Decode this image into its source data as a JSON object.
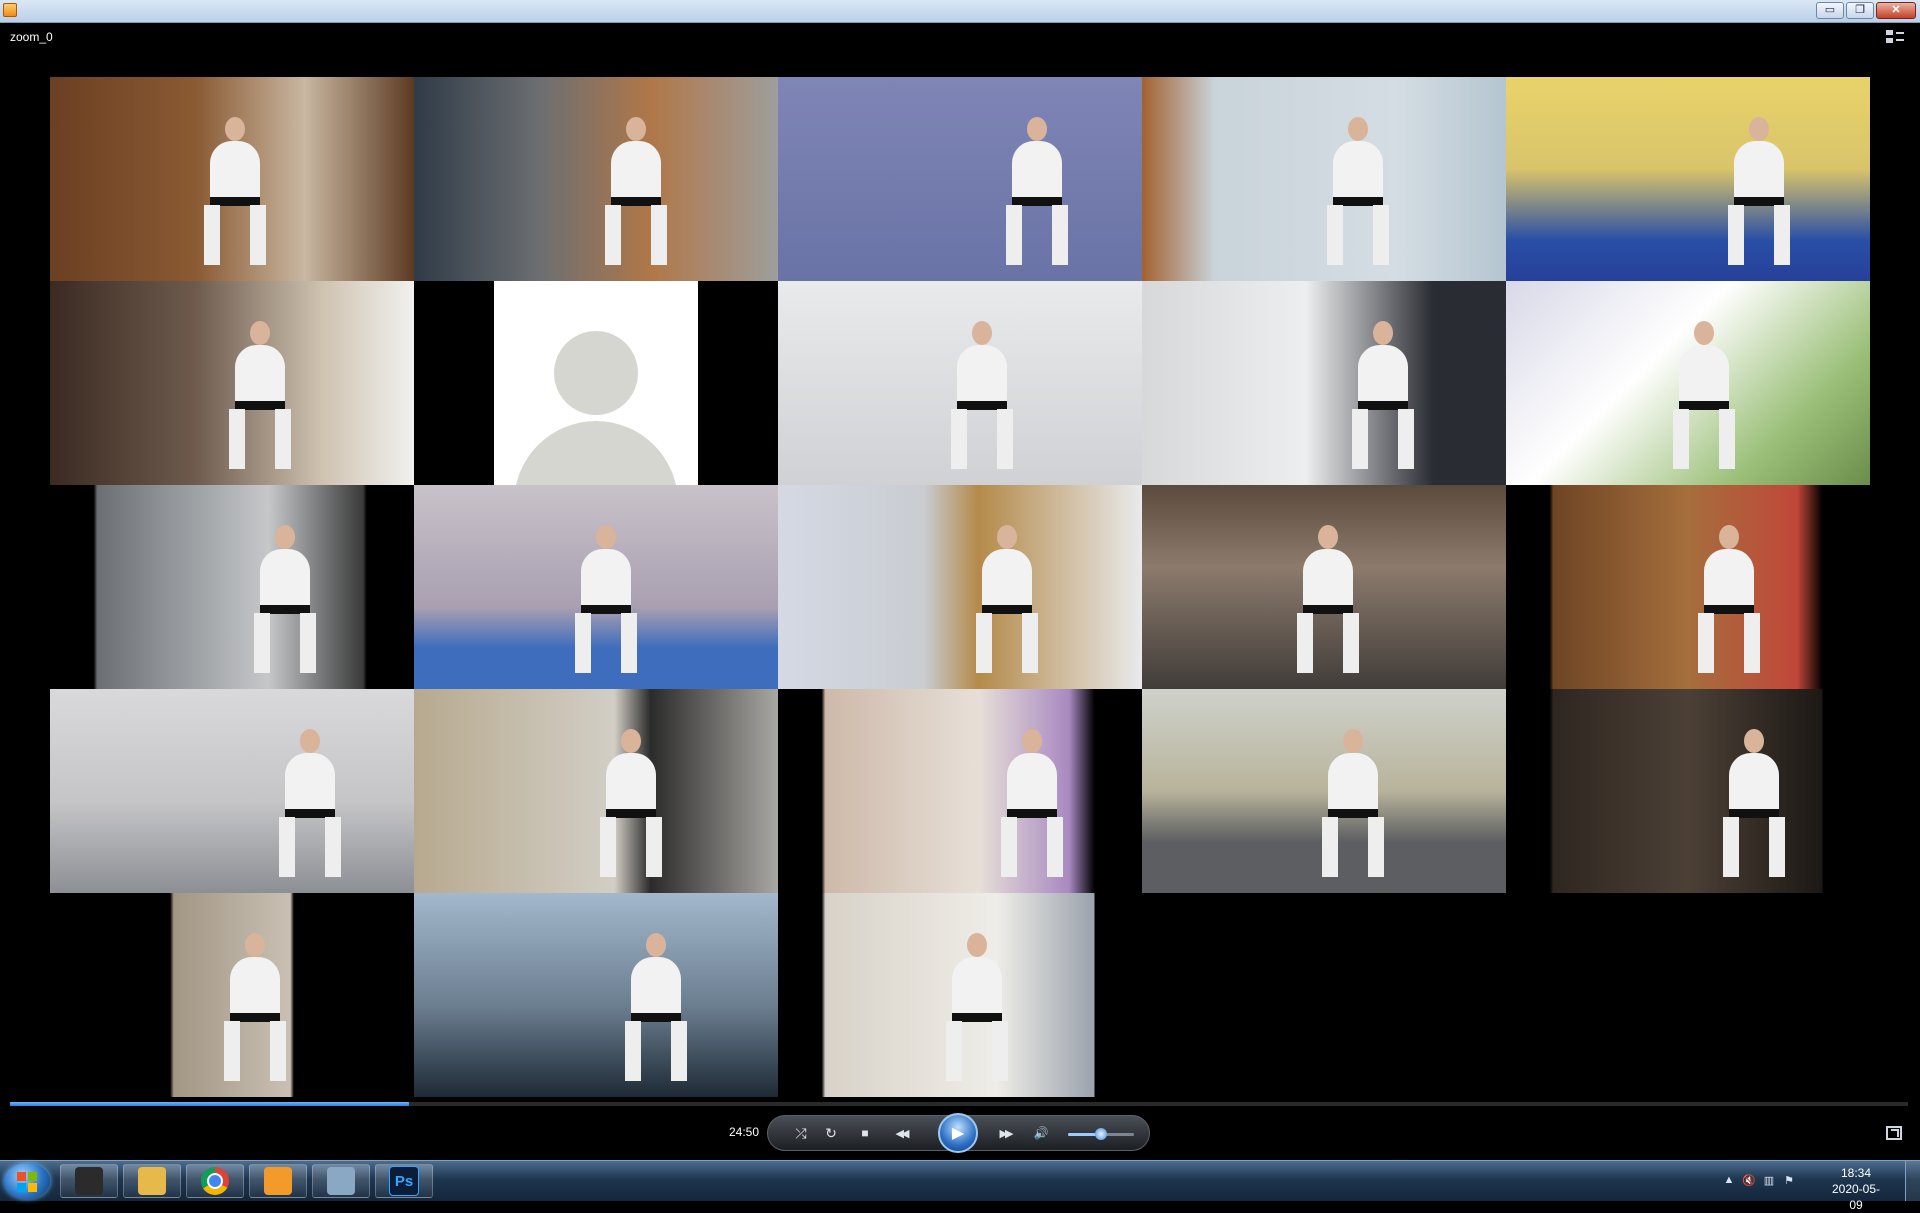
{
  "window": {
    "title": "",
    "buttons": {
      "minimize": "▭",
      "restore": "❐",
      "close": "✕"
    }
  },
  "player": {
    "media_title": "zoom_0",
    "elapsed": "24:50",
    "progress_fraction": 0.21,
    "volume_fraction": 0.5,
    "icons": {
      "layout": "layout-toggle-icon",
      "shuffle": "shuffle-icon",
      "repeat": "repeat-icon",
      "stop": "stop-icon",
      "previous": "rewind-icon",
      "play": "play-icon",
      "next": "fast-forward-icon",
      "mute": "speaker-icon",
      "fullscreen": "fullscreen-icon"
    },
    "glyphs": {
      "shuffle": "⤮",
      "repeat": "↻",
      "stop": "■",
      "previous": "◀◀",
      "play": "▶",
      "next": "▶▶",
      "mute": "🔊"
    }
  },
  "gallery": {
    "participants": 23,
    "placeholder_tile": 7
  },
  "taskbar": {
    "apps": [
      {
        "name": "wolf-app-icon",
        "label": "",
        "color": "#2b2b2b"
      },
      {
        "name": "file-explorer-icon",
        "label": "",
        "color": "#e6b94a"
      },
      {
        "name": "chrome-icon",
        "label": "",
        "color": "#db4437"
      },
      {
        "name": "media-player-icon",
        "label": "",
        "color": "#f39a2b"
      },
      {
        "name": "calculator-icon",
        "label": "",
        "color": "#8aa7c4"
      },
      {
        "name": "photoshop-icon",
        "label": "Ps",
        "color": "#0c1d3a"
      }
    ],
    "clock": {
      "time": "18:34",
      "date": "2020-05-09"
    }
  },
  "colors": {
    "accent": "#2f7fd8",
    "background": "#000000",
    "taskbar": "#1e3650"
  }
}
